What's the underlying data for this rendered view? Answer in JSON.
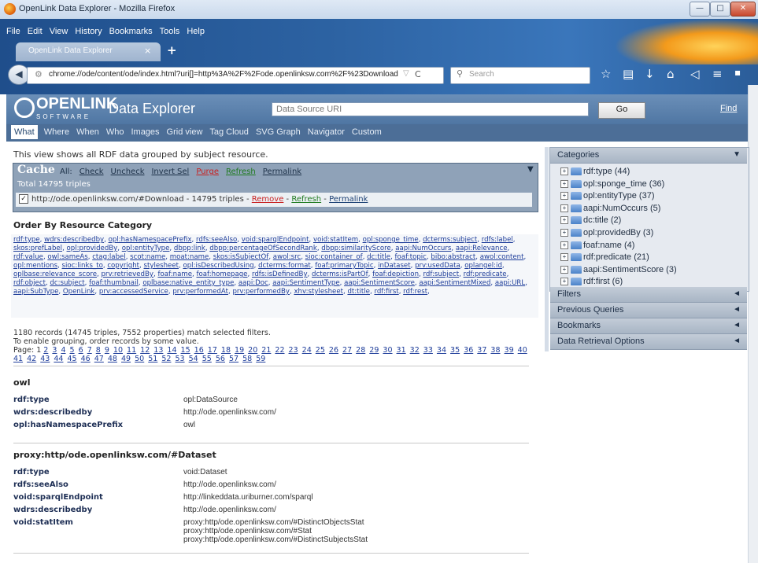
{
  "window": {
    "title": "OpenLink Data Explorer - Mozilla Firefox",
    "controls": {
      "minimize": "—",
      "maximize": "□",
      "close": "✕"
    }
  },
  "browser": {
    "menus": [
      "File",
      "Edit",
      "View",
      "History",
      "Bookmarks",
      "Tools",
      "Help"
    ],
    "tab_label": "OpenLink Data Explorer",
    "tab_close": "×",
    "new_tab": "+",
    "url": "chrome://ode/content/ode/index.html?uri[]=http%3A%2F%2Fode.openlinksw.com%2F%23Download",
    "search_placeholder": "Search",
    "icons": [
      "back-icon",
      "identity-icon",
      "bookmark-star-icon",
      "reload-icon",
      "search-icon",
      "star-icon",
      "reading-list-icon",
      "download-icon",
      "home-icon",
      "pocket-icon",
      "menu-icon",
      "extra-icon"
    ]
  },
  "header": {
    "brand_main": "OPENLINK",
    "brand_sub": "SOFTWARE",
    "app_title": "Data Explorer",
    "datasource_placeholder": "Data Source URI",
    "go_label": "Go",
    "find_label": "Find"
  },
  "view_tabs": [
    "What",
    "Where",
    "When",
    "Who",
    "Images",
    "Grid view",
    "Tag Cloud",
    "SVG Graph",
    "Navigator",
    "Custom"
  ],
  "intro": "This view shows all RDF data grouped by subject resource.",
  "cache": {
    "title": "Cache",
    "all_label": "All:",
    "actions": [
      "Check",
      "Uncheck",
      "Invert Sel",
      "Purge",
      "Refresh",
      "Permalink"
    ],
    "total": "Total 14795 triples",
    "row_uri": "http://ode.openlinksw.com/#Download - 14795 triples -",
    "row_remove": "Remove",
    "row_refresh": "Refresh",
    "row_permalink": "Permalink",
    "sep": "-"
  },
  "order": {
    "title": "Order By Resource Category",
    "links": [
      "rdf:type",
      "wdrs:describedby",
      "opl:hasNamespacePrefix",
      "rdfs:seeAlso",
      "void:sparqlEndpoint",
      "void:statItem",
      "opl:sponge_time",
      "dcterms:subject",
      "rdfs:label",
      "skos:prefLabel",
      "opl:providedBy",
      "opl:entityType",
      "dbpp:link",
      "dbpp:percentageOfSecondRank",
      "dbpp:similarityScore",
      "aapi:NumOccurs",
      "aapi:Relevance",
      "rdf:value",
      "owl:sameAs",
      "ctag:label",
      "scot:name",
      "moat:name",
      "skos:isSubjectOf",
      "awol:src",
      "sioc:container_of",
      "dc:title",
      "foaf:topic",
      "bibo:abstract",
      "awol:content",
      "opl:mentions",
      "sioc:links_to",
      "copyright",
      "stylesheet",
      "opl:isDescribedUsing",
      "dcterms:format",
      "foaf:primaryTopic",
      "inDataset",
      "prv:usedData",
      "oplangel:id",
      "oplbase:relevance_score",
      "prv:retrievedBy",
      "foaf:name",
      "foaf:homepage",
      "rdfs:isDefinedBy",
      "dcterms:isPartOf",
      "foaf:depiction",
      "rdf:subject",
      "rdf:predicate",
      "rdf:object",
      "dc:subject",
      "foaf:thumbnail",
      "oplbase:native_entity_type",
      "aapi:Doc",
      "aapi:SentimentType",
      "aapi:SentimentScore",
      "aapi:SentimentMixed",
      "aapi:URL",
      "aapi:SubType",
      "OpenLink",
      "prv:accessedService",
      "prv:performedAt",
      "prv:performedBy",
      "xhv:stylesheet",
      "dt:title",
      "rdf:first",
      "rdf:rest"
    ]
  },
  "records": {
    "summary": "1180 records (14745 triples, 7552 properties) match selected filters.",
    "grouping_hint": "To enable grouping, order records by some value.",
    "page_label": "Page: 1",
    "pages": [
      "2",
      "3",
      "4",
      "5",
      "6",
      "7",
      "8",
      "9",
      "10",
      "11",
      "12",
      "13",
      "14",
      "15",
      "16",
      "17",
      "18",
      "19",
      "20",
      "21",
      "22",
      "23",
      "24",
      "25",
      "26",
      "27",
      "28",
      "29",
      "30",
      "31",
      "32",
      "33",
      "34",
      "35",
      "36",
      "37",
      "38",
      "39",
      "40",
      "41",
      "42",
      "43",
      "44",
      "45",
      "46",
      "47",
      "48",
      "49",
      "50",
      "51",
      "52",
      "53",
      "54",
      "55",
      "56",
      "57",
      "58",
      "59"
    ]
  },
  "sections": [
    {
      "title": "owl",
      "rows": [
        {
          "prop": "rdf:type",
          "values": [
            "opl:DataSource"
          ]
        },
        {
          "prop": "wdrs:describedby",
          "values": [
            "http://ode.openlinksw.com/"
          ]
        },
        {
          "prop": "opl:hasNamespacePrefix",
          "values": [
            "owl"
          ]
        }
      ]
    },
    {
      "title": "proxy:http/ode.openlinksw.com/#Dataset",
      "rows": [
        {
          "prop": "rdf:type",
          "values": [
            "void:Dataset"
          ]
        },
        {
          "prop": "rdfs:seeAlso",
          "values": [
            "http://ode.openlinksw.com/"
          ]
        },
        {
          "prop": "void:sparqlEndpoint",
          "values": [
            "http://linkeddata.uriburner.com/sparql"
          ]
        },
        {
          "prop": "wdrs:describedby",
          "values": [
            "http://ode.openlinksw.com/"
          ]
        },
        {
          "prop": "void:statItem",
          "values": [
            "proxy:http/ode.openlinksw.com/#DistinctObjectsStat",
            "proxy:http/ode.openlinksw.com/#Stat",
            "proxy:http/ode.openlinksw.com/#DistinctSubjectsStat"
          ]
        }
      ]
    }
  ],
  "sidebar": {
    "categories_title": "Categories",
    "categories_arrow": "▼",
    "categories": [
      "rdf:type (44)",
      "opl:sponge_time (36)",
      "opl:entityType (37)",
      "aapi:NumOccurs (5)",
      "dc:title (2)",
      "opl:providedBy (3)",
      "foaf:name (4)",
      "rdf:predicate (21)",
      "aapi:SentimentScore (3)",
      "rdf:first (6)"
    ],
    "panels": [
      "Filters",
      "Previous Queries",
      "Bookmarks",
      "Data Retrieval Options"
    ],
    "panel_arrow": "◄"
  }
}
